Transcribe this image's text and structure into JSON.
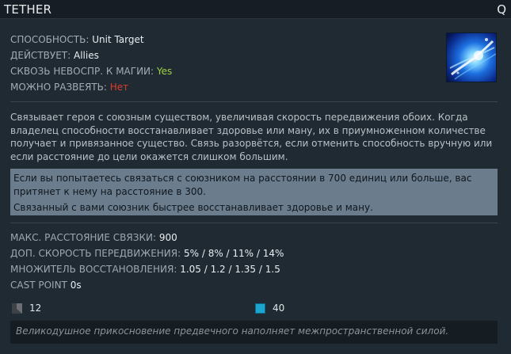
{
  "header": {
    "title": "TETHER",
    "hotkey": "Q"
  },
  "ability_icon": "tether-icon",
  "stats": [
    {
      "label": "СПОСОБНОСТЬ:",
      "value": "Unit Target"
    },
    {
      "label": "ДЕЙСТВУЕТ:",
      "value": "Allies"
    },
    {
      "label": "СКВОЗЬ НЕВОСПР. К МАГИИ:",
      "value": "Yes"
    },
    {
      "label": "МОЖНО РАЗВЕЯТЬ:",
      "value": "Нет"
    }
  ],
  "description": "Связывает героя с союзным существом, увеличивая скорость передвижения обоих. Когда владелец способности восстанавливает здоровье или ману, их в приумноженном количестве получает и привязанное существо. Связь разорвётся, если отменить способность вручную или если расстояние до цели окажется слишком большим.",
  "notes": [
    "Если вы попытаетесь связаться с союзником на расстоянии в 700 единиц или больше, вас притянет к нему на расстояние в 300.",
    "Связанный с вами союзник быстрее восстанавливает здоровье и ману."
  ],
  "attributes": [
    {
      "label": "МАКС. РАССТОЯНИЕ СВЯЗКИ:",
      "value": "900"
    },
    {
      "label": "ДОП. СКОРОСТЬ ПЕРЕДВИЖЕНИЯ:",
      "value": "5% / 8% / 11% / 14%"
    },
    {
      "label": "МНОЖИТЕЛЬ ВОССТАНОВЛЕНИЯ:",
      "value": "1.05 / 1.2 / 1.35 / 1.5"
    },
    {
      "label": "CAST POINT",
      "value": "0s"
    }
  ],
  "costs": {
    "cooldown": {
      "icon": "cooldown-icon",
      "value": "12"
    },
    "mana": {
      "icon": "mana-icon",
      "value": "40",
      "color": "#1aa6cf"
    }
  },
  "lore": "Великодушное прикосновение предвечного наполняет межпространственной силой.",
  "colors": {
    "yes": "#9fd243",
    "no": "#e03b2a",
    "note_bg": "#6b7c8d"
  }
}
